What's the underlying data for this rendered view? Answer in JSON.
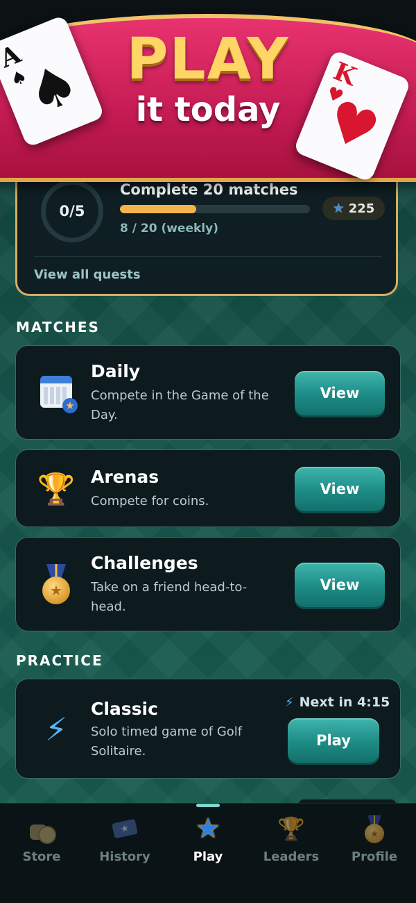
{
  "banner": {
    "title": "PLAY",
    "subtitle": "it today",
    "card_left": {
      "rank": "A",
      "suit": "♠"
    },
    "card_right": {
      "rank": "K",
      "suit": "♥"
    }
  },
  "quest": {
    "ring_text": "0/5",
    "title": "Complete 20 matches",
    "progress_fraction": 0.4,
    "progress_text": "8 / 20 (weekly)",
    "reward": "225",
    "view_all": "View all quests"
  },
  "matches": {
    "heading": "MATCHES",
    "items": [
      {
        "title": "Daily",
        "desc": "Compete in the Game of the Day.",
        "button": "View",
        "icon": "calendar-icon"
      },
      {
        "title": "Arenas",
        "desc": "Compete for coins.",
        "button": "View",
        "icon": "trophy-icon"
      },
      {
        "title": "Challenges",
        "desc": "Take on a friend head-to-head.",
        "button": "View",
        "icon": "medal-icon"
      }
    ]
  },
  "practice": {
    "heading": "PRACTICE",
    "items": [
      {
        "title": "Classic",
        "desc": "Solo timed game of Golf Solitaire.",
        "timer": "Next in 4:15",
        "button": "Play",
        "icon": "lightning-icon"
      }
    ]
  },
  "nav": {
    "items": [
      {
        "label": "Store",
        "icon": "coins-icon"
      },
      {
        "label": "History",
        "icon": "ticket-icon"
      },
      {
        "label": "Play",
        "icon": "star-icon",
        "active": true
      },
      {
        "label": "Leaders",
        "icon": "trophy-icon"
      },
      {
        "label": "Profile",
        "icon": "medal-icon"
      }
    ]
  },
  "colors": {
    "accent": "#1d8b85",
    "banner": "#c41b53",
    "gold": "#f1b54b"
  }
}
